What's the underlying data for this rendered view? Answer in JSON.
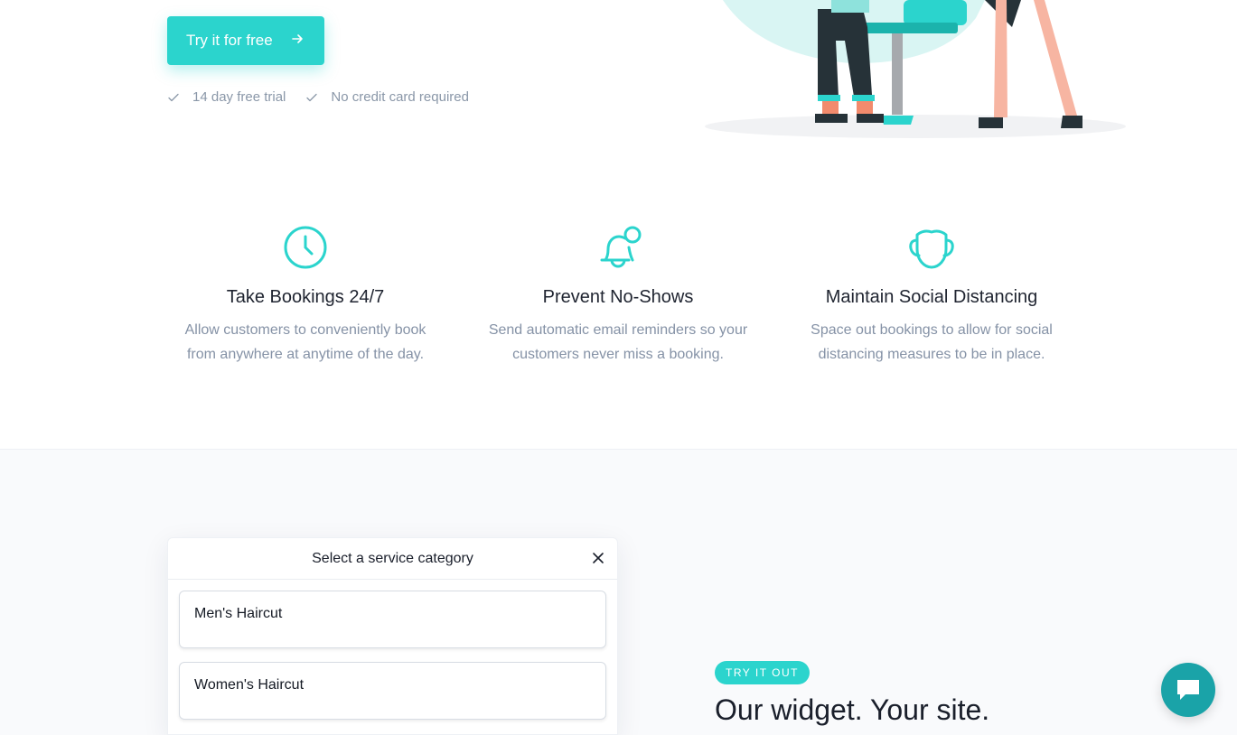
{
  "hero": {
    "cta_label": "Try it for free",
    "checks": [
      "14 day free trial",
      "No credit card required"
    ]
  },
  "features": [
    {
      "icon": "clock-icon",
      "title": "Take Bookings 24/7",
      "description_lines": [
        "Allow customers to conveniently book",
        "from anywhere at anytime of the day."
      ]
    },
    {
      "icon": "bell-icon",
      "title": "Prevent No-Shows",
      "description_lines": [
        "Send automatic email reminders so your",
        "customers never miss a booking."
      ]
    },
    {
      "icon": "face-mask-icon",
      "title": "Maintain Social Distancing",
      "description_lines": [
        "Space out bookings to allow for social",
        "distancing measures to be in place."
      ]
    }
  ],
  "widget": {
    "title": "Select a service category",
    "services": [
      "Men's Haircut",
      "Women's Haircut"
    ]
  },
  "demo": {
    "badge": "TRY IT OUT",
    "heading": "Our widget. Your site."
  },
  "colors": {
    "accent": "#2bd4cd",
    "chat": "#1aa3a8",
    "muted_text": "#8592a6"
  }
}
